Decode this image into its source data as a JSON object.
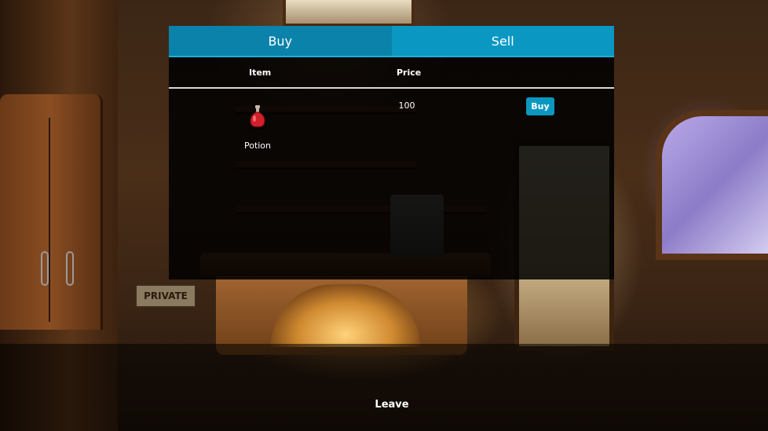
{
  "shop": {
    "tabs": [
      {
        "label": "Buy",
        "active": true
      },
      {
        "label": "Sell",
        "active": false
      }
    ],
    "columns": {
      "item": "Item",
      "price": "Price"
    },
    "items": [
      {
        "name": "Potion",
        "price": "100",
        "icon": "red-potion-icon",
        "action_label": "Buy"
      }
    ]
  },
  "footer": {
    "leave_label": "Leave"
  },
  "background": {
    "sign_text": "PRIVATE"
  },
  "colors": {
    "tab_active": "#0a82aa",
    "tab_inactive": "#0a98c2",
    "buy_button": "#0a98c2"
  }
}
